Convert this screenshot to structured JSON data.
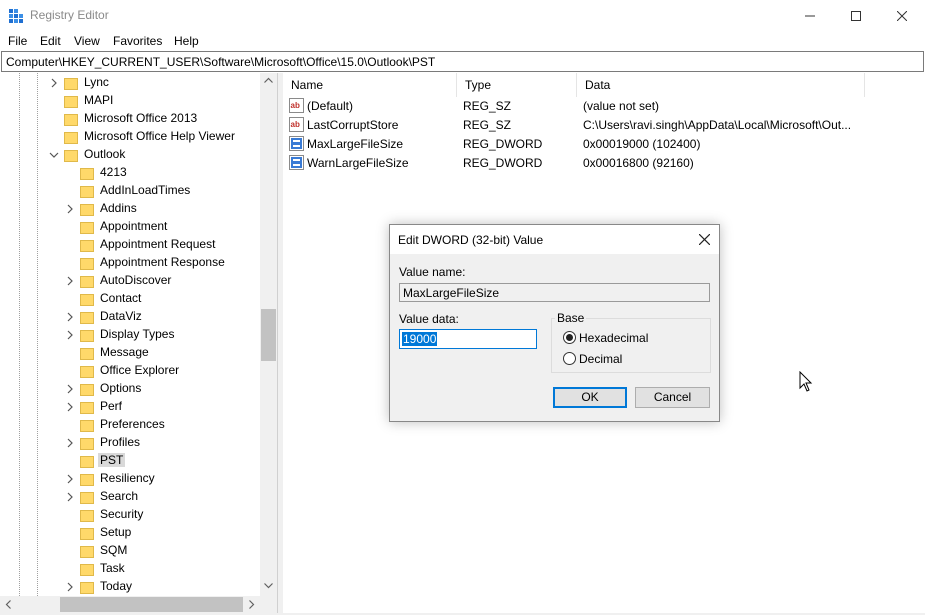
{
  "window": {
    "title": "Registry Editor"
  },
  "menu": [
    "File",
    "Edit",
    "View",
    "Favorites",
    "Help"
  ],
  "address": "Computer\\HKEY_CURRENT_USER\\Software\\Microsoft\\Office\\15.0\\Outlook\\PST",
  "tree": [
    {
      "label": "Lync",
      "expander": "collapsed",
      "level": 0
    },
    {
      "label": "MAPI",
      "expander": "none",
      "level": 0
    },
    {
      "label": "Microsoft Office 2013",
      "expander": "none",
      "level": 0
    },
    {
      "label": "Microsoft Office Help Viewer",
      "expander": "none",
      "level": 0
    },
    {
      "label": "Outlook",
      "expander": "expanded",
      "level": 0
    },
    {
      "label": "4213",
      "expander": "none",
      "level": 1
    },
    {
      "label": "AddInLoadTimes",
      "expander": "none",
      "level": 1
    },
    {
      "label": "Addins",
      "expander": "collapsed",
      "level": 1
    },
    {
      "label": "Appointment",
      "expander": "none",
      "level": 1
    },
    {
      "label": "Appointment Request",
      "expander": "none",
      "level": 1
    },
    {
      "label": "Appointment Response",
      "expander": "none",
      "level": 1
    },
    {
      "label": "AutoDiscover",
      "expander": "collapsed",
      "level": 1
    },
    {
      "label": "Contact",
      "expander": "none",
      "level": 1
    },
    {
      "label": "DataViz",
      "expander": "collapsed",
      "level": 1
    },
    {
      "label": "Display Types",
      "expander": "collapsed",
      "level": 1
    },
    {
      "label": "Message",
      "expander": "none",
      "level": 1
    },
    {
      "label": "Office Explorer",
      "expander": "none",
      "level": 1
    },
    {
      "label": "Options",
      "expander": "collapsed",
      "level": 1
    },
    {
      "label": "Perf",
      "expander": "collapsed",
      "level": 1
    },
    {
      "label": "Preferences",
      "expander": "none",
      "level": 1
    },
    {
      "label": "Profiles",
      "expander": "collapsed",
      "level": 1
    },
    {
      "label": "PST",
      "expander": "none",
      "level": 1,
      "selected": true
    },
    {
      "label": "Resiliency",
      "expander": "collapsed",
      "level": 1
    },
    {
      "label": "Search",
      "expander": "collapsed",
      "level": 1
    },
    {
      "label": "Security",
      "expander": "none",
      "level": 1
    },
    {
      "label": "Setup",
      "expander": "none",
      "level": 1
    },
    {
      "label": "SQM",
      "expander": "none",
      "level": 1
    },
    {
      "label": "Task",
      "expander": "none",
      "level": 1
    },
    {
      "label": "Today",
      "expander": "collapsed",
      "level": 1
    }
  ],
  "columns": {
    "name": "Name",
    "type": "Type",
    "data": "Data"
  },
  "values": [
    {
      "name": "(Default)",
      "type": "REG_SZ",
      "data": "(value not set)",
      "icon": "string-value-icon"
    },
    {
      "name": "LastCorruptStore",
      "type": "REG_SZ",
      "data": "C:\\Users\\ravi.singh\\AppData\\Local\\Microsoft\\Out...",
      "icon": "string-value-icon"
    },
    {
      "name": "MaxLargeFileSize",
      "type": "REG_DWORD",
      "data": "0x00019000 (102400)",
      "icon": "binary-value-icon"
    },
    {
      "name": "WarnLargeFileSize",
      "type": "REG_DWORD",
      "data": "0x00016800 (92160)",
      "icon": "binary-value-icon"
    }
  ],
  "dialog": {
    "title": "Edit DWORD (32-bit) Value",
    "value_name_label": "Value name:",
    "value_name": "MaxLargeFileSize",
    "value_data_label": "Value data:",
    "value_data": "19000",
    "base_label": "Base",
    "radio_hex": "Hexadecimal",
    "radio_dec": "Decimal",
    "selected_base": "Hexadecimal",
    "ok": "OK",
    "cancel": "Cancel"
  },
  "colors": {
    "accent": "#0078d7",
    "folder": "#ffd96a",
    "selection": "#d9d9d9"
  }
}
